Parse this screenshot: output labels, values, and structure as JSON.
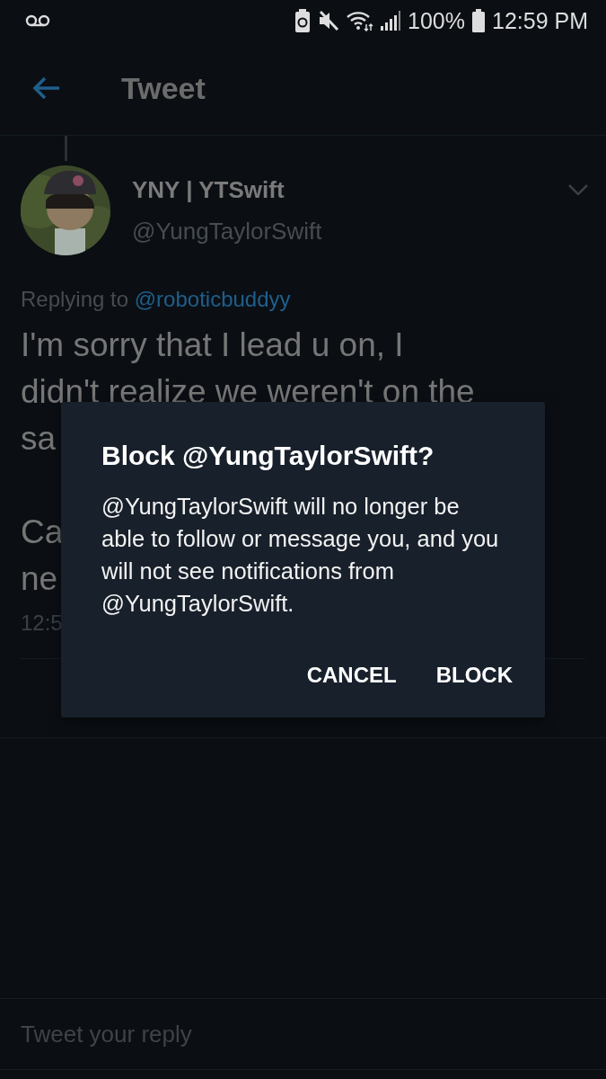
{
  "status_bar": {
    "battery_percent": "100%",
    "time": "12:59 PM"
  },
  "header": {
    "title": "Tweet"
  },
  "tweet": {
    "display_name": "YNY | YTSwift",
    "handle": "@YungTaylorSwift",
    "replying_label": "Replying to",
    "replying_to": "@roboticbuddyy",
    "paragraphs": [
      [
        "I'm sorry that I lead u on, I",
        "didn't realize we weren't on the",
        "sa"
      ],
      [
        "Ca",
        "ne"
      ]
    ],
    "time": "12:5"
  },
  "dialog": {
    "title": "Block @YungTaylorSwift?",
    "message": "@YungTaylorSwift will no longer be able to follow or message you, and you will not see notifications from @YungTaylorSwift.",
    "buttons": [
      "CANCEL",
      "BLOCK"
    ]
  },
  "reply": {
    "placeholder": "Tweet your reply"
  }
}
